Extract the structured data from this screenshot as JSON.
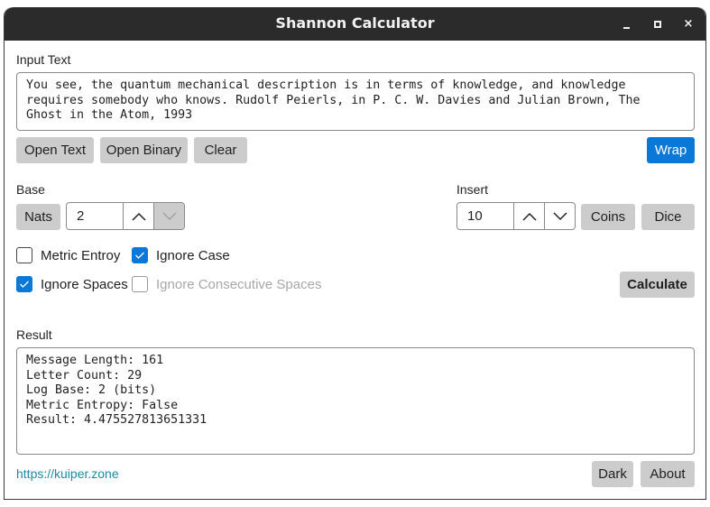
{
  "window": {
    "title": "Shannon Calculator",
    "controls": {
      "minimize": "minimize",
      "maximize": "maximize",
      "close": "×"
    }
  },
  "input": {
    "label": "Input Text",
    "value": "You see, the quantum mechanical description is in terms of knowledge, and knowledge\nrequires somebody who knows. Rudolf Peierls, in P. C. W. Davies and Julian Brown, The\nGhost in the Atom, 1993",
    "buttons": {
      "open_text": "Open Text",
      "open_binary": "Open Binary",
      "clear": "Clear",
      "wrap": "Wrap"
    }
  },
  "base": {
    "label": "Base",
    "nats_button": "Nats",
    "value": "2"
  },
  "insert": {
    "label": "Insert",
    "value": "10",
    "coins_button": "Coins",
    "dice_button": "Dice"
  },
  "options": {
    "metric_entropy": {
      "label": "Metric Entroy",
      "checked": false,
      "enabled": true
    },
    "ignore_case": {
      "label": "Ignore Case",
      "checked": true,
      "enabled": true
    },
    "ignore_spaces": {
      "label": "Ignore Spaces",
      "checked": true,
      "enabled": true
    },
    "ignore_consecutive_spaces": {
      "label": "Ignore Consecutive Spaces",
      "checked": false,
      "enabled": false
    }
  },
  "calculate_button": "Calculate",
  "result": {
    "label": "Result",
    "value": "Message Length: 161\nLetter Count: 29\nLog Base: 2 (bits)\nMetric Entropy: False\nResult: 4.475527813651331"
  },
  "footer": {
    "link": "https://kuiper.zone",
    "dark_button": "Dark",
    "about_button": "About"
  },
  "colors": {
    "accent": "#0a78d7",
    "titlebar": "#2b2b2b",
    "button": "#cccccc",
    "link": "#1a8aa6"
  }
}
